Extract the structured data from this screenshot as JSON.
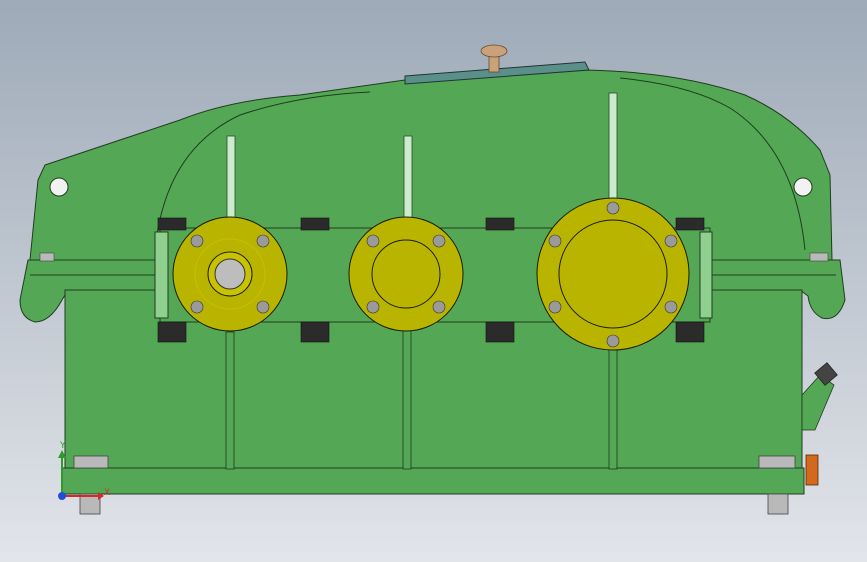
{
  "viewport": {
    "background_top": "#9eaab8",
    "background_bottom": "#e2e5ea"
  },
  "model": {
    "housing_color": "#54a754",
    "housing_edge_color": "#1f3d1f",
    "bearing_cap_color": "#b8b400",
    "bearing_cap_inner_color": "#c6c000",
    "bolt_color": "#2b2b2b",
    "nut_color": "#b9b9b9",
    "inspection_cover_color": "#5a8f8a",
    "breather_color": "#c9a27a",
    "oil_plug_color": "#d2691e",
    "rib_color": "#ccebcc"
  },
  "triad": {
    "x_label": "X",
    "y_label": "Y",
    "x_color": "#d62828",
    "y_color": "#2e9a2e",
    "z_color": "#1f4fd6"
  }
}
